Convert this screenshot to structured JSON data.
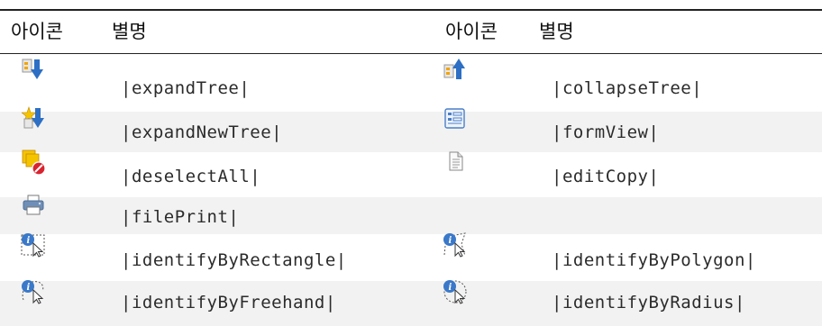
{
  "header": {
    "col1_icon": "아이콘",
    "col1_alias": "별명",
    "col2_icon": "아이콘",
    "col2_alias": "별명"
  },
  "rows": [
    {
      "left": {
        "icon": "expand-tree-icon",
        "alias": "|expandTree|"
      },
      "right": {
        "icon": "collapse-tree-icon",
        "alias": "|collapseTree|"
      }
    },
    {
      "left": {
        "icon": "expand-new-tree-icon",
        "alias": "|expandNewTree|"
      },
      "right": {
        "icon": "form-view-icon",
        "alias": "|formView|"
      }
    },
    {
      "left": {
        "icon": "deselect-all-icon",
        "alias": "|deselectAll|"
      },
      "right": {
        "icon": "edit-copy-icon",
        "alias": "|editCopy|"
      }
    },
    {
      "left": {
        "icon": "file-print-icon",
        "alias": "|filePrint|"
      },
      "right": {
        "icon": "",
        "alias": ""
      }
    },
    {
      "left": {
        "icon": "identify-by-rectangle-icon",
        "alias": "|identifyByRectangle|"
      },
      "right": {
        "icon": "identify-by-polygon-icon",
        "alias": "|identifyByPolygon|"
      }
    },
    {
      "left": {
        "icon": "identify-by-freehand-icon",
        "alias": "|identifyByFreehand|"
      },
      "right": {
        "icon": "identify-by-radius-icon",
        "alias": "|identifyByRadius|"
      }
    }
  ]
}
